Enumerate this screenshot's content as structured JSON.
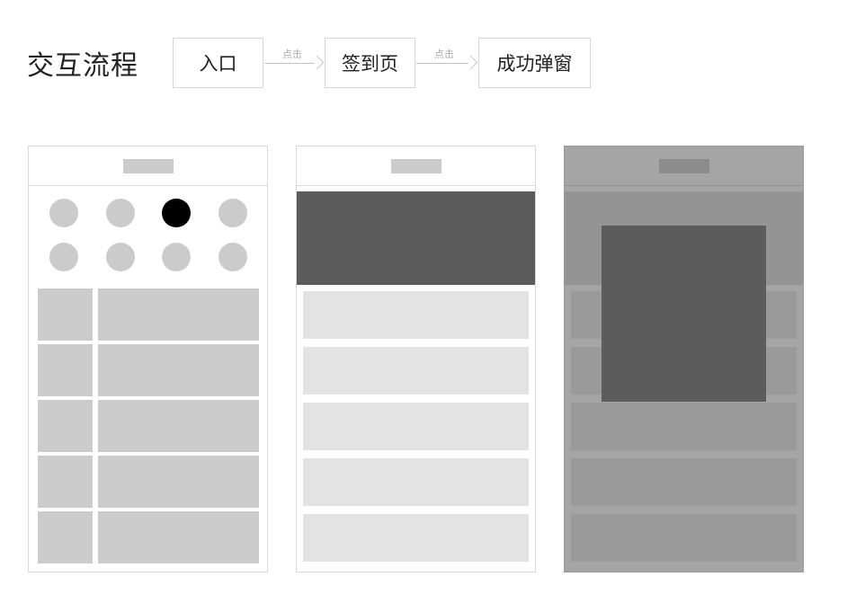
{
  "title": "交互流程",
  "flow": {
    "steps": [
      "入口",
      "签到页",
      "成功弹窗"
    ],
    "arrow_label": "点击"
  },
  "colors": {
    "placeholder": "#cbcbcb",
    "selected_dot": "#000000",
    "banner": "#5c5c5c",
    "list_row": "#e3e3e3",
    "overlay": "#a5a5a5",
    "modal": "#5c5c5c"
  }
}
